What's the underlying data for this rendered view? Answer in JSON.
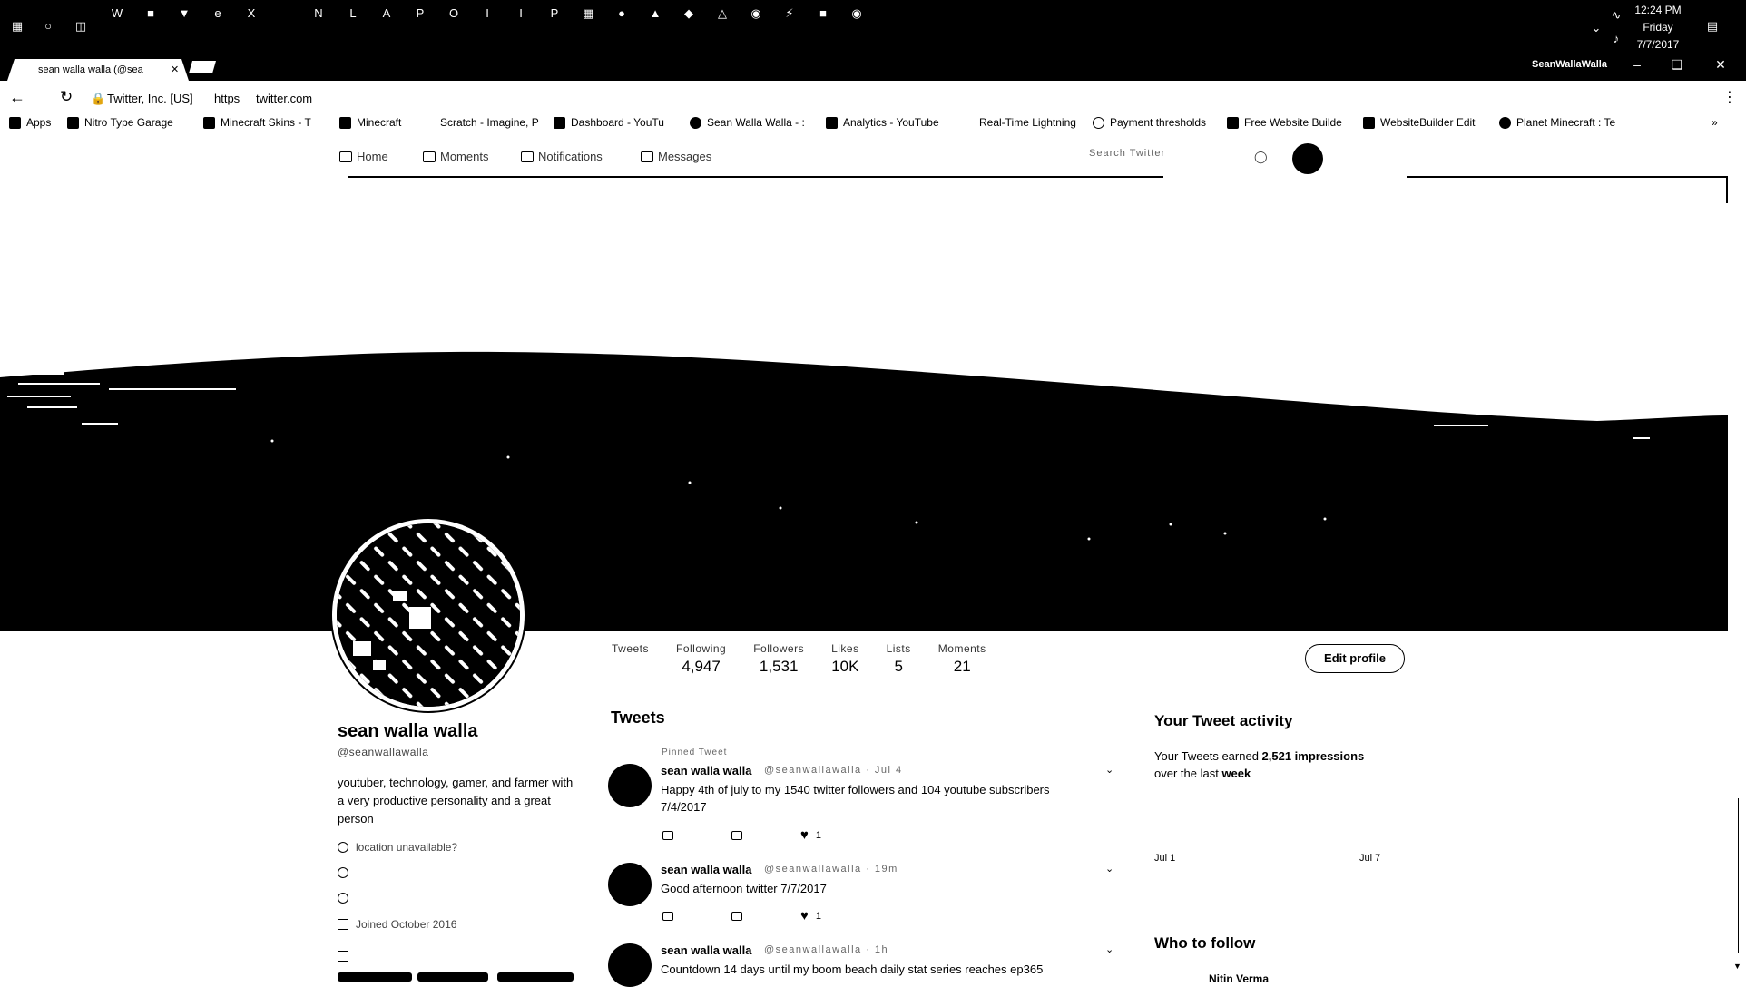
{
  "taskbar": {
    "time": "12:24 PM",
    "day": "Friday",
    "date": "7/7/2017"
  },
  "browser": {
    "tab_title": "sean walla walla (@sea",
    "window_user": "SeanWallaWalla",
    "site_identity": "Twitter, Inc. [US]",
    "url_scheme": "https",
    "url_host": "twitter.com",
    "bookmarks": [
      "Apps",
      "Nitro Type Garage",
      "Minecraft Skins - T",
      "Minecraft",
      "Scratch - Imagine, P",
      "Dashboard - YouTu",
      "Sean Walla Walla - :",
      "Analytics - YouTube",
      "Real-Time Lightning",
      "Payment thresholds",
      "Free Website Builde",
      "WebsiteBuilder Edit",
      "Planet Minecraft : Te"
    ]
  },
  "nav": {
    "home": "Home",
    "moments": "Moments",
    "notifications": "Notifications",
    "messages": "Messages",
    "search_placeholder": "Search Twitter"
  },
  "profile": {
    "name": "sean walla walla",
    "handle": "@seanwallawalla",
    "bio": "youtuber, technology, gamer, and farmer with a very productive personality and a great person",
    "location": "location unavailable?",
    "joined": "Joined October 2016",
    "edit_label": "Edit profile",
    "stats": [
      {
        "label": "Tweets",
        "value": ""
      },
      {
        "label": "Following",
        "value": "4,947"
      },
      {
        "label": "Followers",
        "value": "1,531"
      },
      {
        "label": "Likes",
        "value": "10K"
      },
      {
        "label": "Lists",
        "value": "5"
      },
      {
        "label": "Moments",
        "value": "21"
      }
    ]
  },
  "tweets": {
    "header": "Tweets",
    "pinned_label": "Pinned Tweet",
    "items": [
      {
        "name": "sean walla walla",
        "handle": "@seanwallawalla · Jul 4",
        "text": "Happy 4th of july to my 1540 twitter followers and 104 youtube subscribers 7/4/2017",
        "likes": "1"
      },
      {
        "name": "sean walla walla",
        "handle": "@seanwallawalla · 19m",
        "text": "Good afternoon twitter 7/7/2017",
        "likes": "1"
      },
      {
        "name": "sean walla walla",
        "handle": "@seanwallawalla · 1h",
        "text": "Countdown 14 days until my boom beach daily stat series reaches ep365",
        "likes": ""
      }
    ]
  },
  "activity": {
    "title": "Your Tweet activity",
    "text_prefix": "Your Tweets earned ",
    "impressions": "2,521 impressions",
    "text_mid": "over the last ",
    "period": "week",
    "start_date": "Jul 1",
    "end_date": "Jul 7"
  },
  "who_to_follow": {
    "title": "Who to follow",
    "first_name": "Nitin Verma"
  }
}
